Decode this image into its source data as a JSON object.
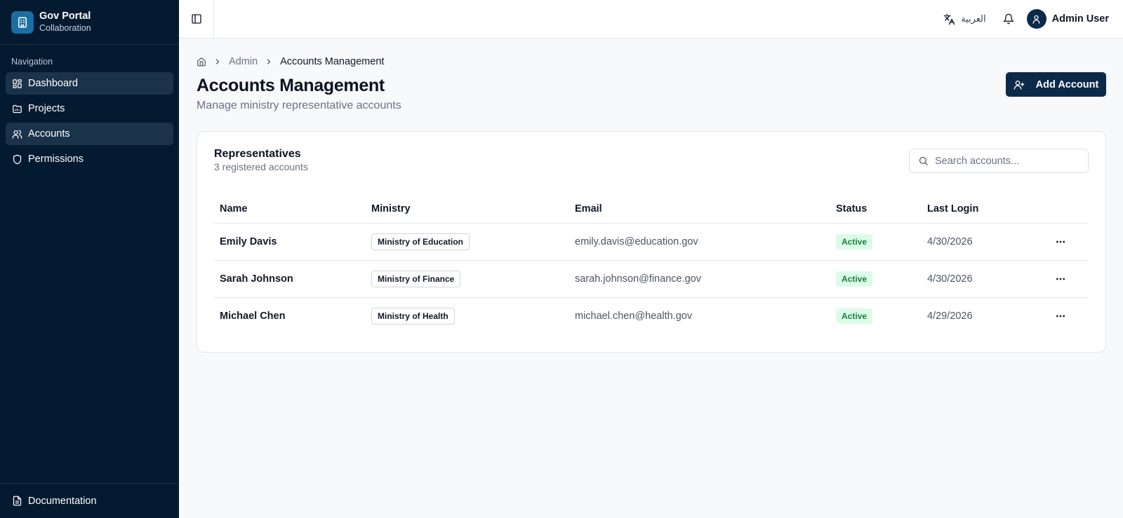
{
  "brand": {
    "title": "Gov Portal",
    "subtitle": "Collaboration"
  },
  "sidebar": {
    "heading": "Navigation",
    "items": [
      {
        "label": "Dashboard",
        "icon": "dashboard-icon",
        "active": true
      },
      {
        "label": "Projects",
        "icon": "folder-icon",
        "active": false
      },
      {
        "label": "Accounts",
        "icon": "users-icon",
        "active": true
      },
      {
        "label": "Permissions",
        "icon": "shield-icon",
        "active": false
      }
    ],
    "footer": {
      "label": "Documentation",
      "icon": "file-text-icon"
    }
  },
  "topbar": {
    "language_label": "العربية",
    "user_name": "Admin User"
  },
  "breadcrumb": {
    "parent": "Admin",
    "current": "Accounts Management"
  },
  "page": {
    "title": "Accounts Management",
    "subtitle": "Manage ministry representative accounts",
    "add_button_label": "Add Account"
  },
  "card": {
    "title": "Representatives",
    "subtitle": "3 registered accounts",
    "search_placeholder": "Search accounts..."
  },
  "table": {
    "columns": [
      "Name",
      "Ministry",
      "Email",
      "Status",
      "Last Login"
    ],
    "rows": [
      {
        "name": "Emily Davis",
        "ministry": "Ministry of Education",
        "email": "emily.davis@education.gov",
        "status": "Active",
        "last_login": "4/30/2026"
      },
      {
        "name": "Sarah Johnson",
        "ministry": "Ministry of Finance",
        "email": "sarah.johnson@finance.gov",
        "status": "Active",
        "last_login": "4/30/2026"
      },
      {
        "name": "Michael Chen",
        "ministry": "Ministry of Health",
        "email": "michael.chen@health.gov",
        "status": "Active",
        "last_login": "4/29/2026"
      }
    ]
  },
  "colors": {
    "sidebar_bg": "#041a31",
    "primary": "#0b2a4a",
    "brand_logo": "#1a6ea1",
    "status_active_bg": "#dcfce7",
    "status_active_text": "#15803d"
  }
}
